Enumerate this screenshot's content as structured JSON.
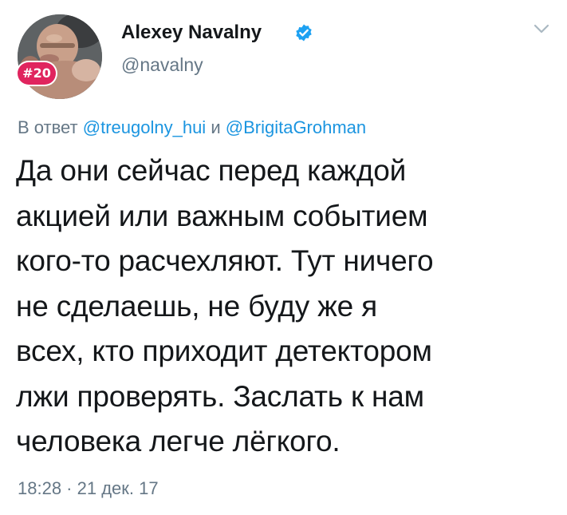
{
  "tweet": {
    "author": {
      "display_name": "Alexey Navalny",
      "handle": "@navalny",
      "verified": true,
      "avatar_badge": "#20",
      "avatar_icon": "profile-photo"
    },
    "reply": {
      "prefix": "В ответ",
      "mention_1": "@treugolny_hui",
      "conjunction": "и",
      "mention_2": "@BrigitaGrohman"
    },
    "text": "Да они сейчас перед каждой\nакцией или важным событием\nкого-то расчехляют. Тут ничего\nне сделаешь, не буду же я\nвсех, кто приходит детектором\nлжи проверять. Заслать к нам\nчеловека легче лёгкого.",
    "timestamp": "18:28 · 21 дек. 17",
    "menu_icon": "chevron-down-icon"
  },
  "colors": {
    "text": "#14171a",
    "secondary": "#657786",
    "link": "#1b95e0",
    "verified": "#1da1f2",
    "badge": "#e0245e"
  }
}
